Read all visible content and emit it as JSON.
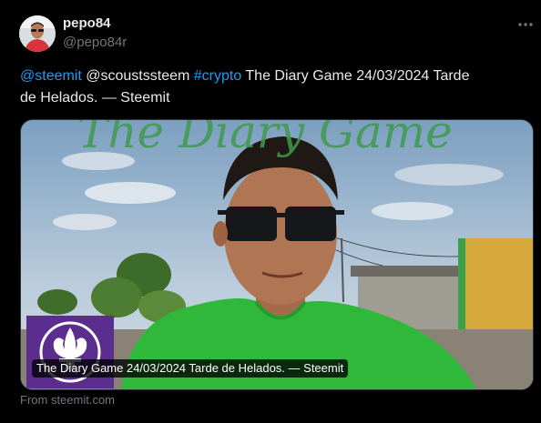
{
  "author": {
    "display_name": "pepo84",
    "handle": "@pepo84r"
  },
  "tweet": {
    "mention_1": "@steemit",
    "mention_2": "@scoustssteem",
    "hashtag": "#crypto",
    "text_line1": "The Diary Game 24/03/2024 Tarde",
    "text_line2": "de Helados. — Steemit"
  },
  "card": {
    "overlay_title": "The Diary Game",
    "caption": "The Diary Game 24/03/2024 Tarde de Helados. — Steemit",
    "source": "From steemit.com"
  },
  "colors": {
    "background": "#000000",
    "link": "#1d9bf0",
    "text": "#e7e9ea",
    "muted": "#71767b",
    "shirt_green": "#2fb83a",
    "scout_purple": "#5b2d8e",
    "overlay_green": "#3f9a4c"
  },
  "icons": {
    "more": "more-horizontal-icon",
    "scout_logo": "fleur-de-lis-icon"
  }
}
